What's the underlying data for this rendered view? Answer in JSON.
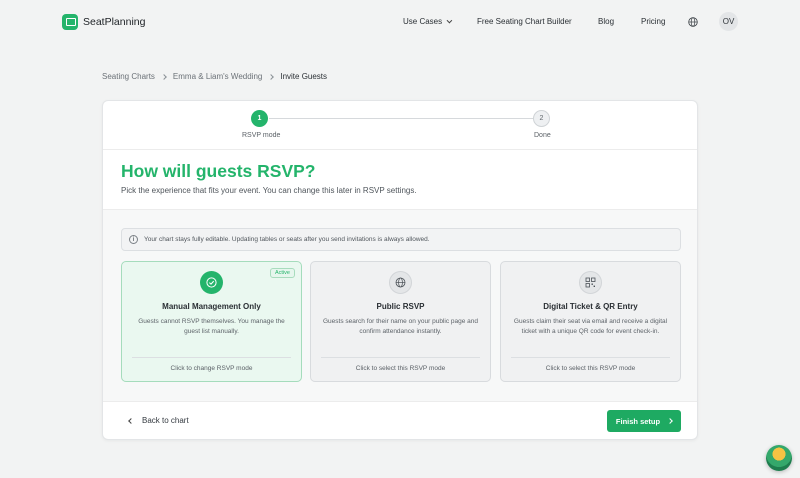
{
  "nav": {
    "brand": "SeatPlanning",
    "use_cases": "Use Cases",
    "free_builder": "Free Seating Chart Builder",
    "blog": "Blog",
    "pricing": "Pricing",
    "avatar_initials": "OV"
  },
  "breadcrumb": {
    "items": [
      "Seating Charts",
      "Emma & Liam's Wedding"
    ],
    "current": "Invite Guests"
  },
  "stepper": {
    "steps": [
      {
        "number": "1",
        "label": "RSVP mode"
      },
      {
        "number": "2",
        "label": "Done"
      }
    ],
    "active_step": 1
  },
  "header": {
    "title": "How will guests RSVP?",
    "subtitle": "Pick the experience that fits your event. You can change this later in RSVP settings."
  },
  "notice": {
    "icon": "info-icon",
    "text": "Your chart stays fully editable. Updating tables or seats after you send invitations is always allowed."
  },
  "options": [
    {
      "title": "Manual Management Only",
      "description": "Guests cannot RSVP themselves. You manage the guest list manually.",
      "action": "Click to change RSVP mode",
      "badge": "Active",
      "icon": "check-circle-icon",
      "active": true
    },
    {
      "title": "Public RSVP",
      "description": "Guests search for their name on your public page and confirm attendance instantly.",
      "action": "Click to select this RSVP mode",
      "icon": "globe-icon",
      "active": false
    },
    {
      "title": "Digital Ticket & QR Entry",
      "description": "Guests claim their seat via email and receive a digital ticket with a unique QR code for event check-in.",
      "action": "Click to select this RSVP mode",
      "icon": "qr-code-icon",
      "active": false
    }
  ],
  "footer": {
    "back_label": "Back to chart",
    "finish_label": "Finish setup"
  },
  "colors": {
    "accent": "#24b46b",
    "background": "#f2f3f3"
  }
}
